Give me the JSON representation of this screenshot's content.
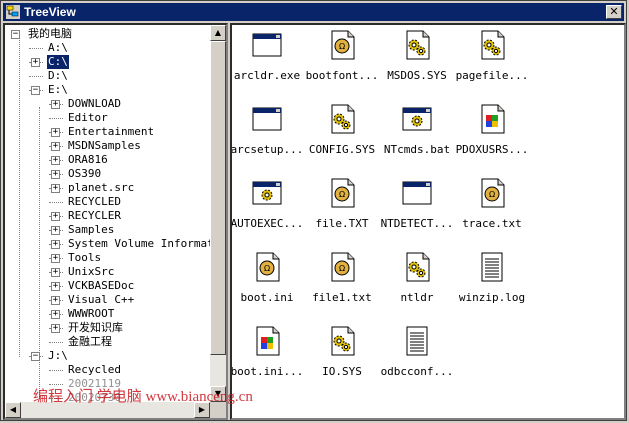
{
  "window": {
    "title": "TreeView",
    "close_glyph": "✕"
  },
  "tree": {
    "items": [
      {
        "label": "我的电脑",
        "level": 0,
        "expander": "−",
        "selected": false
      },
      {
        "label": "A:\\",
        "level": 1,
        "expander": "",
        "selected": false
      },
      {
        "label": "C:\\",
        "level": 1,
        "expander": "+",
        "selected": true
      },
      {
        "label": "D:\\",
        "level": 1,
        "expander": "",
        "selected": false
      },
      {
        "label": "E:\\",
        "level": 1,
        "expander": "−",
        "selected": false
      },
      {
        "label": "DOWNLOAD",
        "level": 2,
        "expander": "+"
      },
      {
        "label": "Editor",
        "level": 2,
        "expander": ""
      },
      {
        "label": "Entertainment",
        "level": 2,
        "expander": "+"
      },
      {
        "label": "MSDNSamples",
        "level": 2,
        "expander": "+"
      },
      {
        "label": "ORA816",
        "level": 2,
        "expander": "+"
      },
      {
        "label": "OS390",
        "level": 2,
        "expander": "+"
      },
      {
        "label": "planet.src",
        "level": 2,
        "expander": "+"
      },
      {
        "label": "RECYCLED",
        "level": 2,
        "expander": ""
      },
      {
        "label": "RECYCLER",
        "level": 2,
        "expander": "+"
      },
      {
        "label": "Samples",
        "level": 2,
        "expander": "+"
      },
      {
        "label": "System Volume Information",
        "level": 2,
        "expander": "+"
      },
      {
        "label": "Tools",
        "level": 2,
        "expander": "+"
      },
      {
        "label": "UnixSrc",
        "level": 2,
        "expander": "+"
      },
      {
        "label": "VCKBASEDoc",
        "level": 2,
        "expander": "+"
      },
      {
        "label": "Visual C++",
        "level": 2,
        "expander": "+"
      },
      {
        "label": "WWWROOT",
        "level": 2,
        "expander": "+"
      },
      {
        "label": "开发知识库",
        "level": 2,
        "expander": "+"
      },
      {
        "label": "金融工程",
        "level": 2,
        "expander": ""
      },
      {
        "label": "J:\\",
        "level": 1,
        "expander": "−"
      },
      {
        "label": "Recycled",
        "level": 2,
        "expander": ""
      },
      {
        "label": "20021119",
        "level": 2,
        "expander": "",
        "faded": true
      },
      {
        "label": "20020730",
        "level": 2,
        "expander": "",
        "faded": true
      }
    ],
    "scroll_up": "▲",
    "scroll_down": "▼",
    "scroll_left": "◀",
    "scroll_right": "▶"
  },
  "files": [
    {
      "name": "arcldr.exe",
      "icon": "exe-window-icon"
    },
    {
      "name": "bootfont...",
      "icon": "system-file-icon"
    },
    {
      "name": "MSDOS.SYS",
      "icon": "gear-settings-icon"
    },
    {
      "name": "pagefile...",
      "icon": "gear-settings-icon"
    },
    {
      "name": "arcsetup...",
      "icon": "exe-window-icon"
    },
    {
      "name": "CONFIG.SYS",
      "icon": "gear-settings-icon"
    },
    {
      "name": "NTcmds.bat",
      "icon": "batch-window-icon"
    },
    {
      "name": "PDOXUSRS...",
      "icon": "installer-icon"
    },
    {
      "name": "AUTOEXEC...",
      "icon": "batch-window-icon"
    },
    {
      "name": "file.TXT",
      "icon": "system-file-icon"
    },
    {
      "name": "NTDETECT...",
      "icon": "exe-window-icon"
    },
    {
      "name": "trace.txt",
      "icon": "system-file-icon"
    },
    {
      "name": "boot.ini",
      "icon": "system-file-icon"
    },
    {
      "name": "file1.txt",
      "icon": "system-file-icon"
    },
    {
      "name": "ntldr",
      "icon": "gear-settings-icon"
    },
    {
      "name": "winzip.log",
      "icon": "text-document-icon"
    },
    {
      "name": "boot.ini...",
      "icon": "installer-icon"
    },
    {
      "name": "IO.SYS",
      "icon": "gear-settings-icon"
    },
    {
      "name": "odbcconf...",
      "icon": "text-document-icon"
    }
  ],
  "watermark": "编程入门 学电脑 www.bianceng.cn",
  "colors": {
    "title_bar": "#0a246a",
    "selection": "#0a246a",
    "watermark": "#c8171e"
  }
}
